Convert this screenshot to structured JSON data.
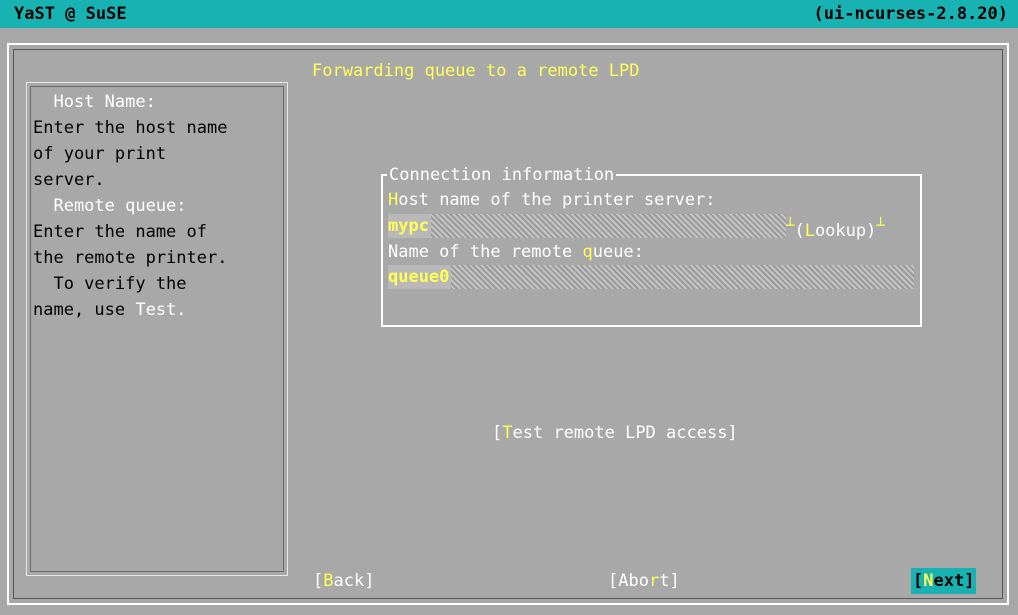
{
  "titlebar": {
    "app": "YaST @ SuSE",
    "version": "(ui-ncurses-2.8.20)"
  },
  "help": {
    "lines": [
      {
        "text": "  Host Name:",
        "style": "hd"
      },
      {
        "text": "Enter the host name"
      },
      {
        "text": "of your print"
      },
      {
        "text": "server."
      },
      {
        "text": "  Remote queue:",
        "style": "hd"
      },
      {
        "text": "Enter the name of"
      },
      {
        "text": "the remote printer."
      },
      {
        "text": "  To verify the"
      },
      {
        "text": "name, use ",
        "tail": "Test."
      }
    ]
  },
  "heading": "Forwarding queue to a remote LPD",
  "connection": {
    "title": "Connection information",
    "host_label_hotkey": "H",
    "host_label_rest": "ost name of the printer server:",
    "host_value": "mypc",
    "lookup_open": "(",
    "lookup_hotkey": "L",
    "lookup_rest": "ookup)",
    "queue_label_pre": "Name of the remote ",
    "queue_label_hotkey": "q",
    "queue_label_rest": "ueue:",
    "queue_value": "queue0"
  },
  "test_button": {
    "open": "[",
    "hotkey": "T",
    "rest": "est remote LPD access]"
  },
  "buttons": {
    "back": {
      "open": "[",
      "hotkey": "B",
      "rest": "ack]"
    },
    "abort": {
      "pre": "[Abo",
      "hotkey": "r",
      "rest": "t]"
    },
    "next": {
      "open": "[",
      "hotkey": "N",
      "rest": "ext]"
    }
  }
}
